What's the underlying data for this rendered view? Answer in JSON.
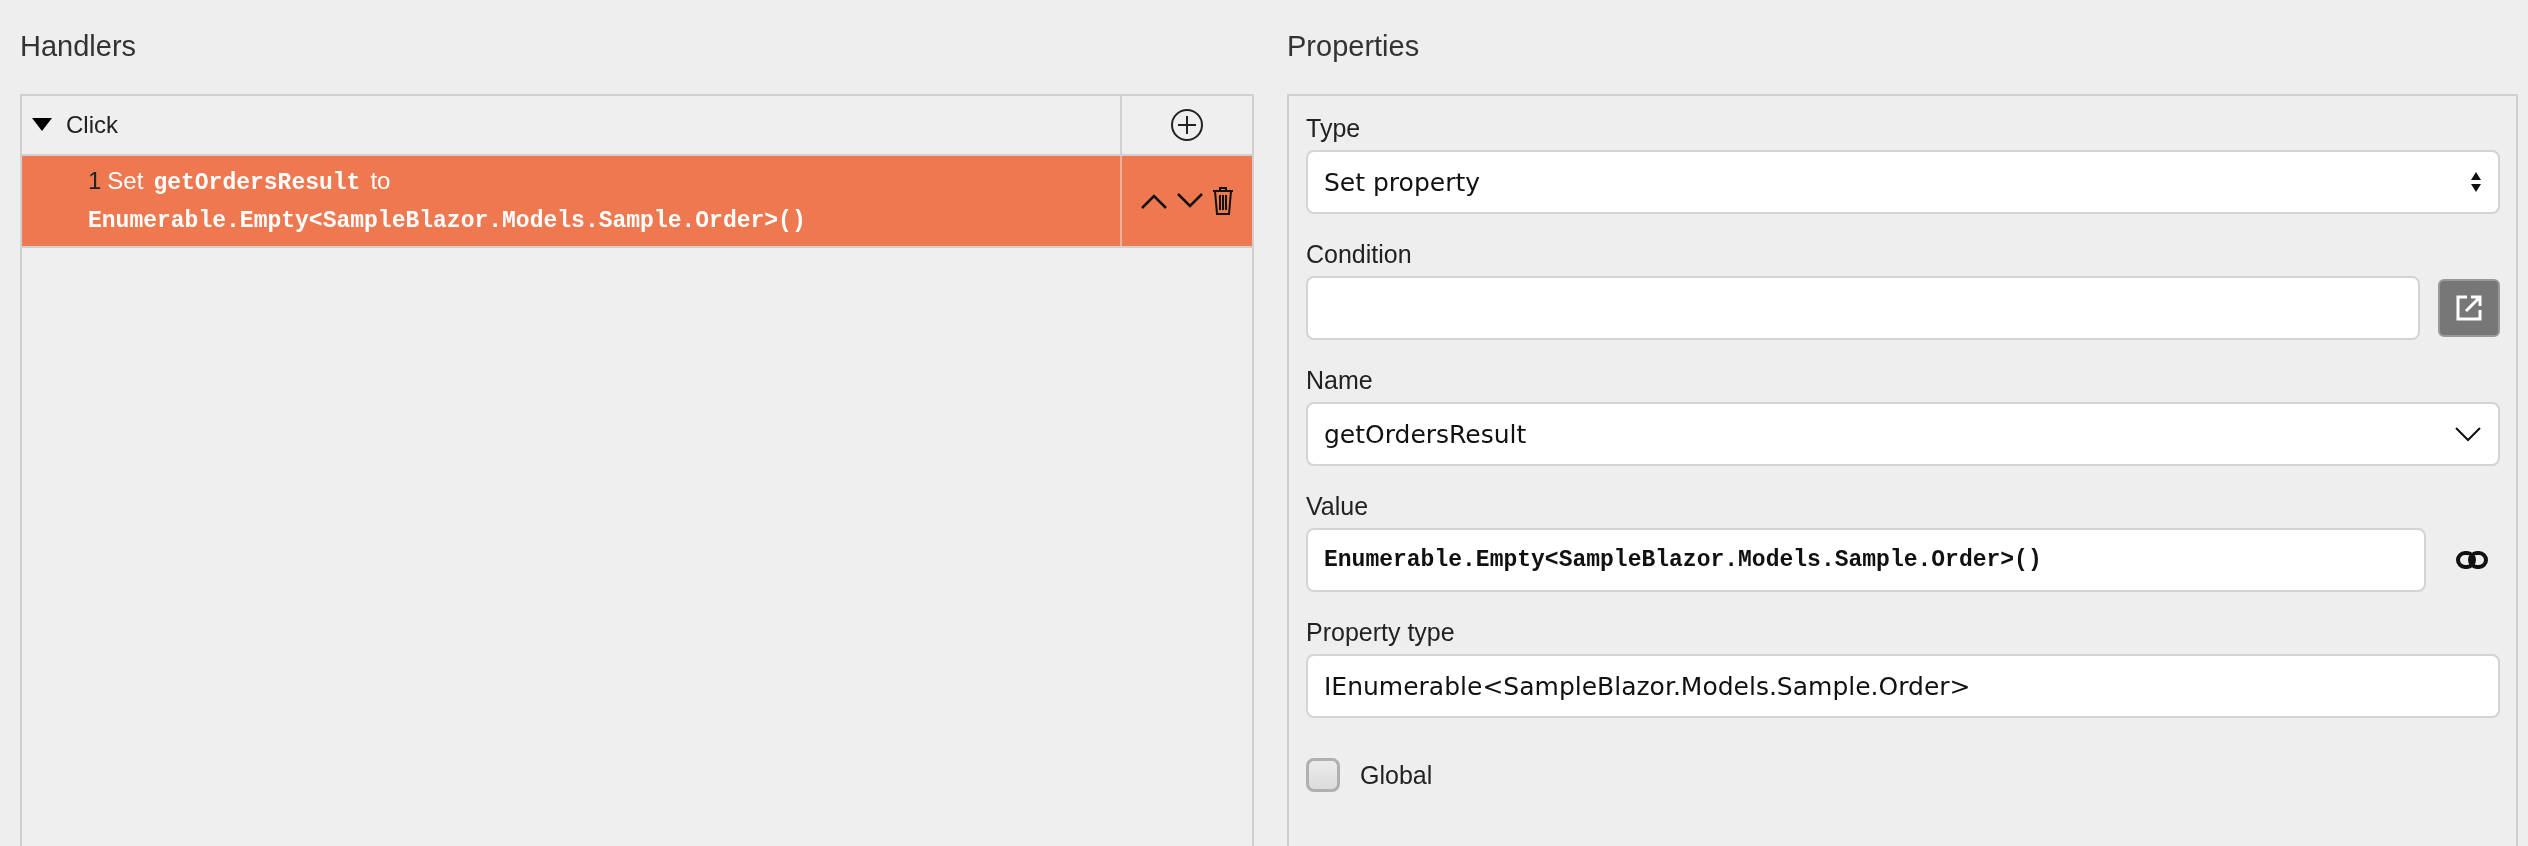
{
  "handlers": {
    "title": "Handlers",
    "events": [
      {
        "name": "Click",
        "expanded": true,
        "actions": [
          {
            "number": "1",
            "verb": "Set",
            "target": "getOrdersResult",
            "connector": "to",
            "value": "Enumerable.Empty<SampleBlazor.Models.Sample.Order>()",
            "selected": true
          }
        ]
      }
    ]
  },
  "properties": {
    "title": "Properties",
    "fields": [
      {
        "kind": "select",
        "label": "Type",
        "value": "Set property"
      },
      {
        "kind": "expression",
        "label": "Condition"
      },
      {
        "kind": "dropdown",
        "label": "Name",
        "value": "getOrdersResult"
      },
      {
        "kind": "code",
        "label": "Value",
        "value": "Enumerable.Empty<SampleBlazor.Models.Sample.Order>()"
      },
      {
        "kind": "text",
        "label": "Property type",
        "value": "IEnumerable<SampleBlazor.Models.Sample.Order>"
      },
      {
        "kind": "checkbox",
        "label": "Global",
        "checked": false
      }
    ]
  }
}
